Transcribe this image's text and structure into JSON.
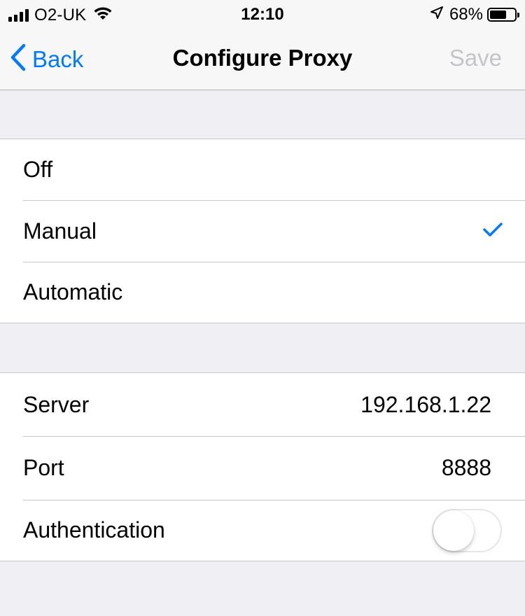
{
  "status_bar": {
    "carrier": "O2-UK",
    "time": "12:10",
    "battery_percent": "68%",
    "battery_level": 0.68,
    "icons": [
      "signal-icon",
      "wifi-icon",
      "location-icon",
      "battery-icon"
    ]
  },
  "nav": {
    "back_label": "Back",
    "title": "Configure Proxy",
    "save_label": "Save"
  },
  "proxy_modes": {
    "options": [
      "Off",
      "Manual",
      "Automatic"
    ],
    "selected": "Manual"
  },
  "settings": {
    "server_label": "Server",
    "server_value": "192.168.1.22",
    "port_label": "Port",
    "port_value": "8888",
    "auth_label": "Authentication",
    "auth_enabled": false
  },
  "colors": {
    "accent": "#007aff",
    "disabled": "#c4c4c9",
    "background": "#efeff4"
  }
}
